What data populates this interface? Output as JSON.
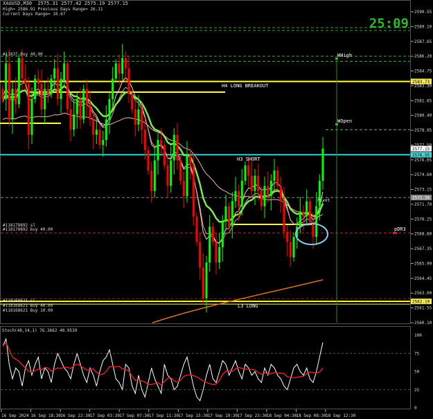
{
  "header": {
    "title": "XAUUSD,M30",
    "ohlc": "2575.31 2577.42 2575.19 2577.15",
    "line1": "High= 2586.91  Previous Days Range= 26.11",
    "line2": "Current Days Range= 10.67",
    "timer": "25:09"
  },
  "price_axis": {
    "ticks": [
      "2590.55",
      "2589.10",
      "2587.65",
      "2586.20",
      "2584.75",
      "2583.30",
      "2581.85",
      "2580.40",
      "2578.95",
      "2577.50",
      "2576.05",
      "2574.60",
      "2573.15",
      "2571.70",
      "2570.25",
      "2568.80",
      "2567.35",
      "2565.90",
      "2564.45",
      "2563.00",
      "2561.55",
      "2560.10"
    ],
    "badges": [
      {
        "text": "2583.73",
        "bg": "#f7ea5c",
        "fg": "#000000"
      },
      {
        "text": "2577.15",
        "bg": "#ffffff",
        "fg": "#000000"
      },
      {
        "text": "2576.55",
        "bg": "#4ad3d3",
        "fg": "#000000"
      },
      {
        "text": "2572.36",
        "bg": "#8a8a8a",
        "fg": "#ffffff"
      },
      {
        "text": "2562.19",
        "bg": "#f7ea5c",
        "fg": "#000000"
      }
    ]
  },
  "time_axis": {
    "ticks": [
      "16 Sep 2024",
      "16 Sep 18:30",
      "16 Sep 22:30",
      "17 Sep 03:30",
      "17 Sep 07:30",
      "17 Sep 11:30",
      "17 Sep 15:30",
      "17 Sep 19:30",
      "17 Sep 23:30",
      "18 Sep 04:30",
      "18 Sep 08:30",
      "18 Sep 12:30"
    ]
  },
  "levels": {
    "h4_long_breakout": "H4 LONG BREAKOUT",
    "h3_short": "H3 SHORT",
    "l3_long": "L3 LONG",
    "whigh": "WHigh",
    "wopen": "WOpen",
    "pivot": "Pivot",
    "pdr3": "pDR3"
  },
  "order_labels": {
    "top": "#11837 Buy 40.00",
    "mid1": "#118178892 sl",
    "mid2": "#118178892 buy 40.00",
    "bot1": "#118168621 sl",
    "bot2": "#118168621 Buy 40.00",
    "bot3": "#118168621 Buy 10.00"
  },
  "stoch": {
    "label": "Stoch(48,14,1) 76.3662 40.9539",
    "ticks": [
      "100",
      "75",
      "50",
      "25",
      "0"
    ]
  },
  "colors": {
    "bull": "#00ff00",
    "bear": "#ff0000",
    "h4": "#ffff4a",
    "h3": "#33d6d6",
    "ma_green": "#7fe850",
    "ma_pink": "#f0b8b0",
    "ma_orange": "#d9731c",
    "grid": "#3a3a3a"
  },
  "chart_data": {
    "type": "candlestick",
    "symbol": "XAUUSD",
    "timeframe": "M30",
    "y_range": [
      2559.5,
      2591.0
    ],
    "candles_close_approx": [
      2582.0,
      2585.5,
      2580.0,
      2583.0,
      2581.5,
      2586.0,
      2584.0,
      2583.5,
      2578.5,
      2582.0,
      2584.0,
      2583.5,
      2581.0,
      2583.0,
      2582.5,
      2584.0,
      2585.0,
      2582.0,
      2584.0,
      2585.5,
      2581.0,
      2579.0,
      2580.5,
      2582.0,
      2580.0,
      2583.0,
      2581.5,
      2580.0,
      2578.5,
      2579.0,
      2577.5,
      2578.0,
      2580.0,
      2582.0,
      2584.0,
      2585.5,
      2584.5,
      2586.0,
      2585.0,
      2582.5,
      2581.0,
      2579.5,
      2581.0,
      2579.0,
      2577.0,
      2575.0,
      2573.0,
      2576.0,
      2578.0,
      2577.5,
      2575.5,
      2573.5,
      2576.0,
      2578.5,
      2576.0,
      2574.0,
      2572.5,
      2576.5,
      2575.5,
      2570.5,
      2568.0,
      2565.5,
      2562.5,
      2566.0,
      2569.5,
      2568.0,
      2566.0,
      2567.5,
      2570.0,
      2571.5,
      2569.5,
      2572.0,
      2573.0,
      2571.5,
      2574.0,
      2575.5,
      2574.5,
      2573.0,
      2574.5,
      2573.0,
      2571.5,
      2573.5,
      2572.5,
      2574.0,
      2575.0,
      2573.5,
      2572.0,
      2569.0,
      2568.0,
      2566.5,
      2568.5,
      2569.5,
      2571.0,
      2570.5,
      2572.0,
      2570.0,
      2568.5,
      2571.5,
      2574.0,
      2577.15
    ]
  }
}
